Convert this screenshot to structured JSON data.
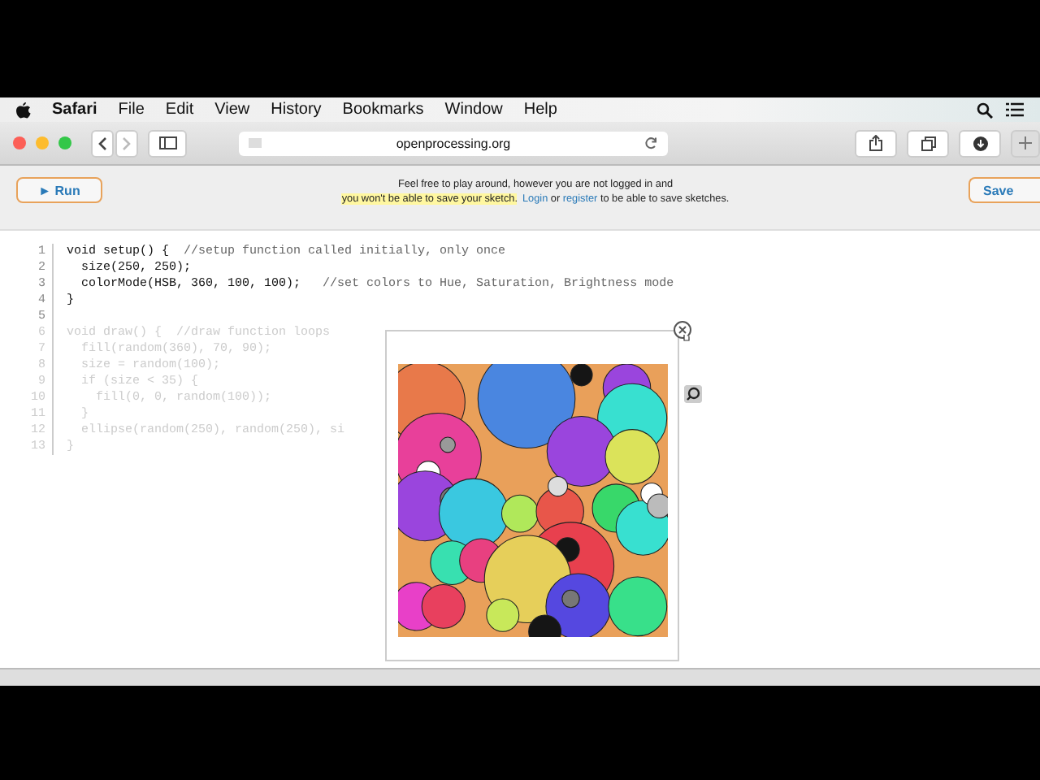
{
  "menu_bar": {
    "app": "Safari",
    "items": [
      "File",
      "Edit",
      "View",
      "History",
      "Bookmarks",
      "Window",
      "Help"
    ]
  },
  "toolbar": {
    "url": "openprocessing.org"
  },
  "page_toolbar": {
    "run_button": "► Run",
    "save_button": "Save",
    "notice_line_1": "Feel free to play around, however you are not logged in and",
    "notice_line_2": [
      {
        "kind": "highlight",
        "text": "you won't be able to save your sketch."
      },
      {
        "kind": "link",
        "text": "Login"
      },
      {
        "kind": "plain",
        "text": " or "
      },
      {
        "kind": "link",
        "text": "register"
      },
      {
        "kind": "plain",
        "text": " to be able to save sketches."
      }
    ]
  },
  "editor": {
    "lines": [
      {
        "number": "1",
        "code": "void setup() {",
        "comment": "  //setup function called initially, only once",
        "faded": false
      },
      {
        "number": "2",
        "code": "  size(250, 250);",
        "faded": false
      },
      {
        "number": "3",
        "code": "  colorMode(HSB, 360, 100, 100);",
        "comment": "   //set colors to Hue, Saturation, Brightness mode",
        "faded": false
      },
      {
        "number": "4",
        "code": "}",
        "faded": false
      },
      {
        "number": "5",
        "faded": false
      },
      {
        "number": "6",
        "code": "void draw() {",
        "comment": "  //draw function loops",
        "faded": true
      },
      {
        "number": "7",
        "code": "  fill(random(360), 70, 90);",
        "faded": true
      },
      {
        "number": "8",
        "code": "  size = random(100);",
        "faded": true
      },
      {
        "number": "9",
        "code": "  if (size < 35) {",
        "faded": true
      },
      {
        "number": "10",
        "code": "    fill(0, 0, random(100));",
        "faded": true
      },
      {
        "number": "11",
        "code": "  }",
        "faded": true
      },
      {
        "number": "12",
        "code": "  ellipse(random(250), random(250), si",
        "faded": true
      },
      {
        "number": "13",
        "code": "}",
        "faded": true
      }
    ]
  }
}
